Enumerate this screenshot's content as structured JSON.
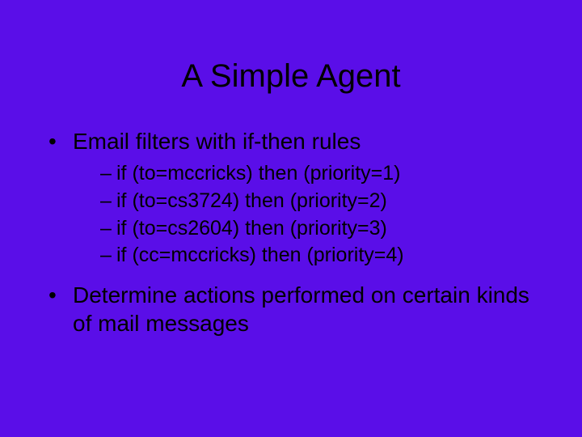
{
  "title": "A Simple Agent",
  "bullet1": "Email filters with if-then rules",
  "sub1": "if (to=mccricks) then (priority=1)",
  "sub2": "if (to=cs3724) then (priority=2)",
  "sub3": "if (to=cs2604) then (priority=3)",
  "sub4": "if (cc=mccricks) then (priority=4)",
  "bullet2": "Determine actions performed on certain kinds of mail messages"
}
